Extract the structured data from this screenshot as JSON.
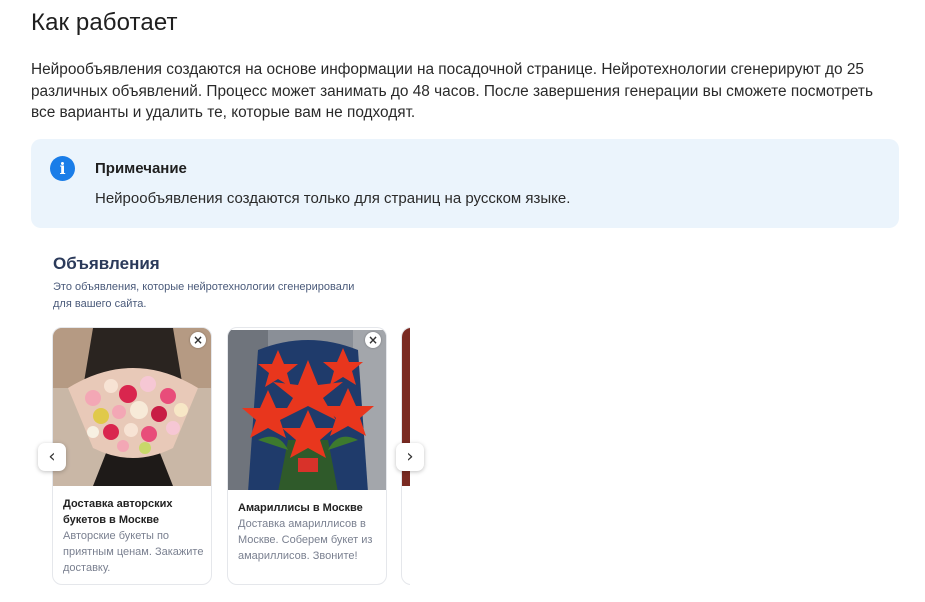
{
  "page": {
    "title": "Как работает",
    "intro": "Нейрообъявления создаются на основе информации на посадочной странице. Нейротехнологии сгенерируют до 25 различных объявлений. Процесс может занимать до 48 часов. После завершения генерации вы сможете посмотреть все варианты и удалить те, которые вам не подходят."
  },
  "note": {
    "icon": "info-icon",
    "icon_glyph": "i",
    "title": "Примечание",
    "text": "Нейрообъявления создаются только для страниц на русском языке."
  },
  "ads_preview": {
    "title": "Объявления",
    "subtitle": "Это объявления, которые нейротехнологии сгенерировали для вашего сайта.",
    "prev_glyph": "‹",
    "next_glyph": "›",
    "close_glyph": "×",
    "cards": [
      {
        "title": "Доставка авторских букетов в Москве",
        "text": "Авторские букеты по приятным ценам. Закажите доставку.",
        "image": "mixed-rose-bouquet"
      },
      {
        "title": "Амариллисы в Москве",
        "text": "Доставка амариллисов в Москве. Соберем букет из амариллисов. Звоните!",
        "image": "red-amaryllis-bouquet"
      }
    ]
  },
  "colors": {
    "note_bg": "#ebf4fc",
    "info_icon": "#1a7de8",
    "preview_title": "#2b3a5a"
  }
}
